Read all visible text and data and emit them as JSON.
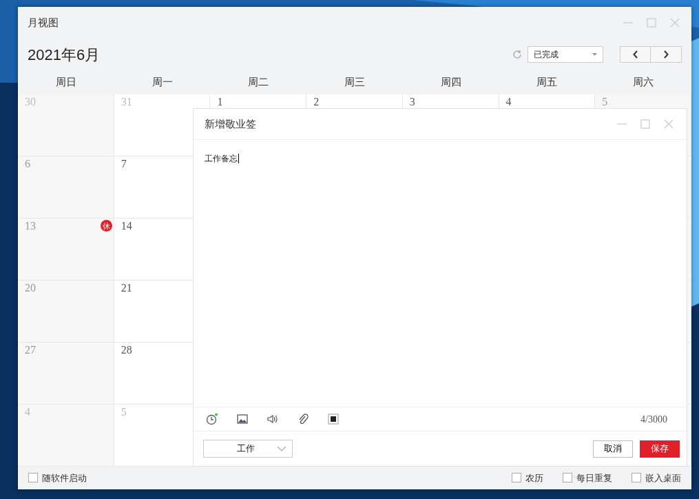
{
  "window": {
    "title": "月视图"
  },
  "header": {
    "month": "2021年6月",
    "filter": "已完成"
  },
  "weekdays": [
    "周日",
    "周一",
    "周二",
    "周三",
    "周四",
    "周五",
    "周六"
  ],
  "weeks": [
    {
      "days": [
        {
          "day": "30",
          "other_month": true
        },
        {
          "day": "31",
          "other_month": true
        },
        {
          "day": "1",
          "other_month": false
        },
        {
          "day": "2",
          "other_month": false
        },
        {
          "day": "3",
          "other_month": false
        },
        {
          "day": "4",
          "other_month": false
        },
        {
          "day": "5",
          "other_month": false
        }
      ]
    },
    {
      "days": [
        {
          "day": "6",
          "other_month": false
        },
        {
          "day": "7",
          "other_month": false
        }
      ]
    },
    {
      "days": [
        {
          "day": "13",
          "other_month": false,
          "badge": "休"
        },
        {
          "day": "14",
          "other_month": false
        }
      ]
    },
    {
      "days": [
        {
          "day": "20",
          "other_month": false
        },
        {
          "day": "21",
          "other_month": false
        }
      ]
    },
    {
      "days": [
        {
          "day": "27",
          "other_month": false
        },
        {
          "day": "28",
          "other_month": false
        }
      ]
    },
    {
      "days": [
        {
          "day": "4",
          "other_month": true
        },
        {
          "day": "5",
          "other_month": true
        }
      ]
    }
  ],
  "footer": {
    "options": [
      {
        "label": "随软件启动",
        "checked": false
      },
      {
        "label": "农历",
        "checked": false
      },
      {
        "label": "每日重复",
        "checked": false
      },
      {
        "label": "嵌入桌面",
        "checked": false
      }
    ]
  },
  "dialog": {
    "title": "新增敬业签",
    "content": "工作备忘",
    "char_count": "4/3000",
    "reminder_set": true,
    "category": "工作",
    "buttons": [
      {
        "label": "取消",
        "kind": "secondary"
      },
      {
        "label": "保存",
        "kind": "primary"
      }
    ]
  }
}
